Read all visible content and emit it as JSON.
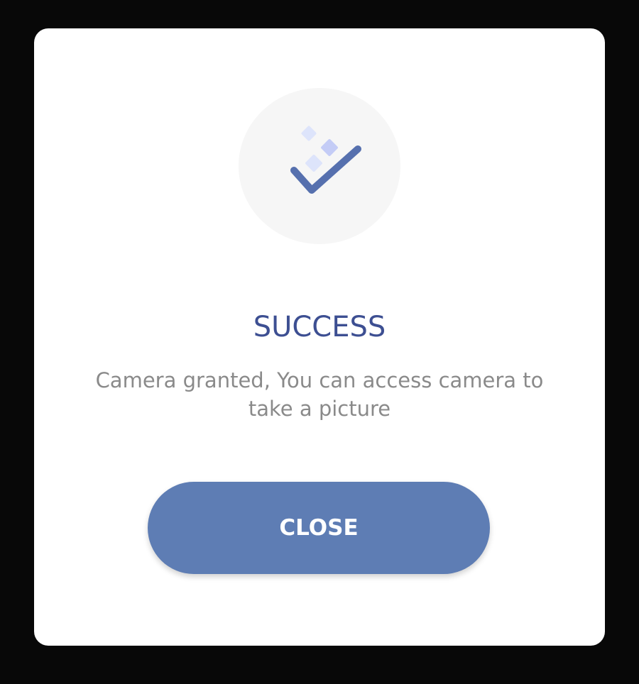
{
  "dialog": {
    "icon": "check-with-sparkles-icon",
    "title": "SUCCESS",
    "message": "Camera granted, You can access camera to take a picture",
    "close_label": "CLOSE"
  },
  "colors": {
    "backdrop": "#080808",
    "dialog_bg": "#ffffff",
    "icon_circle": "#f6f6f6",
    "icon_check": "#5670ae",
    "icon_sparkle_light": "#dde4fb",
    "icon_sparkle_dark": "#c4ccf6",
    "title": "#3d4f92",
    "message": "#8a8a8a",
    "button_bg": "#5e7db4",
    "button_text": "#ffffff"
  }
}
